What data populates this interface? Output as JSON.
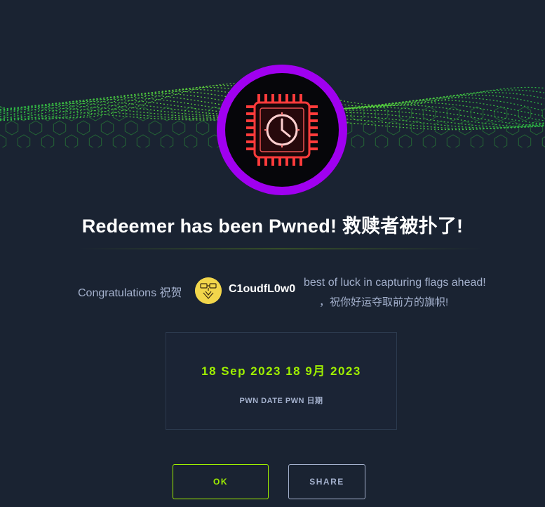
{
  "modal": {
    "title": "Redeemer has been Pwned! 救赎者被扑了!",
    "congrats_label": "Congratulations  祝贺",
    "username": "C1oudfL0w0",
    "luck_message": "best of luck in capturing flags ahead!",
    "luck_message_cn": "，祝你好运夺取前方的旗帜!",
    "pwn_date": "18 Sep 2023 18 9月 2023",
    "pwn_date_label": "PWN DATE PWN 日期",
    "ok_label": "OK",
    "share_label": "SHARE"
  },
  "icons": {
    "banner": "green-wave-banner",
    "badge": "machine-chip-clock-icon",
    "avatar": "user-avatar"
  },
  "colors": {
    "background": "#1a2332",
    "accent_green": "#9fef00",
    "badge_ring": "#a000f0",
    "chip_red": "#ff3b3b",
    "muted_text": "#a4b1cd"
  }
}
